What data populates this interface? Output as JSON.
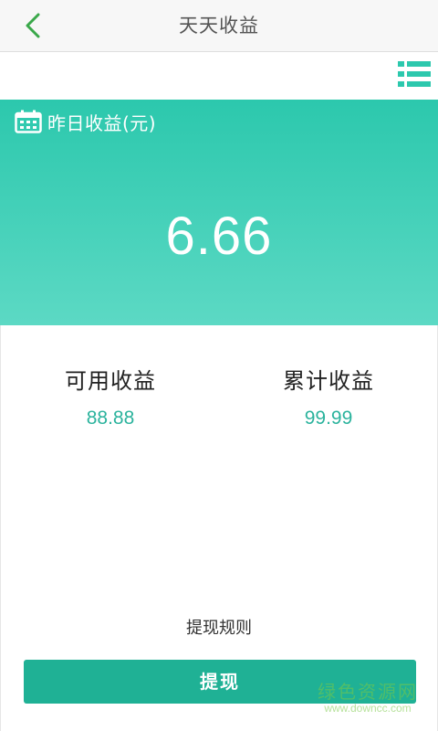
{
  "header": {
    "title": "天天收益"
  },
  "card": {
    "label": "昨日收益(元)",
    "value": "6.66"
  },
  "stats": {
    "available": {
      "label": "可用收益",
      "value": "88.88"
    },
    "total": {
      "label": "累计收益",
      "value": "99.99"
    }
  },
  "actions": {
    "rules": "提现规则",
    "withdraw": "提现"
  },
  "watermark": {
    "cn": "绿色资源网",
    "en": "www.downcc.com"
  },
  "colors": {
    "accent": "#2cc8ad",
    "button": "#1fb195",
    "value_text": "#2bb39d",
    "back_arrow": "#3aa84a"
  },
  "icons": {
    "back": "chevron-left-icon",
    "menu": "list-icon",
    "calendar": "calendar-icon"
  }
}
